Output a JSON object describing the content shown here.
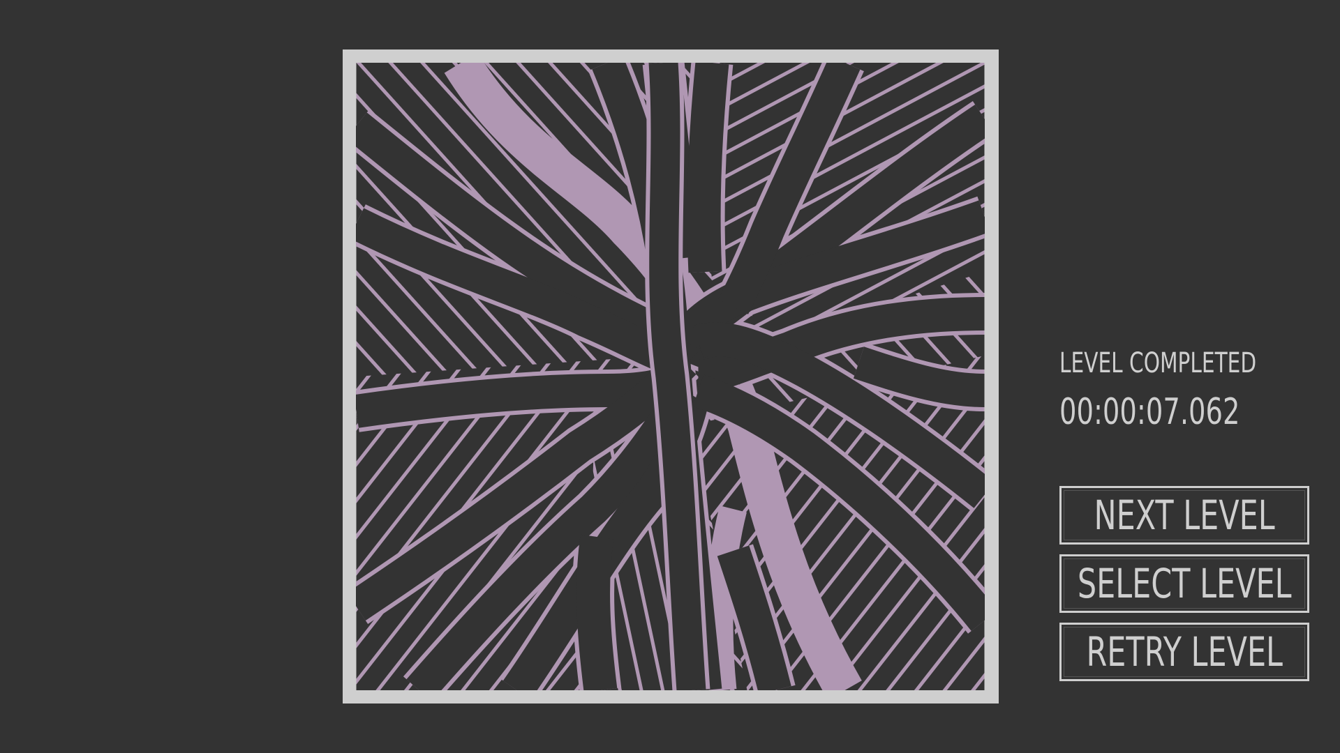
{
  "status": {
    "title": "LEVEL COMPLETED",
    "timer": "00:00:07.062"
  },
  "menu": {
    "next_level": "NEXT LEVEL",
    "select_level": "SELECT LEVEL",
    "retry_level": "RETRY LEVEL"
  },
  "puzzle": {
    "state": "solved",
    "colors": {
      "background": "#333333",
      "frame": "#cfcfcf",
      "band_outline": "#b097b3",
      "band_fill": "#333333",
      "highlight_band": "#b097b3"
    }
  }
}
